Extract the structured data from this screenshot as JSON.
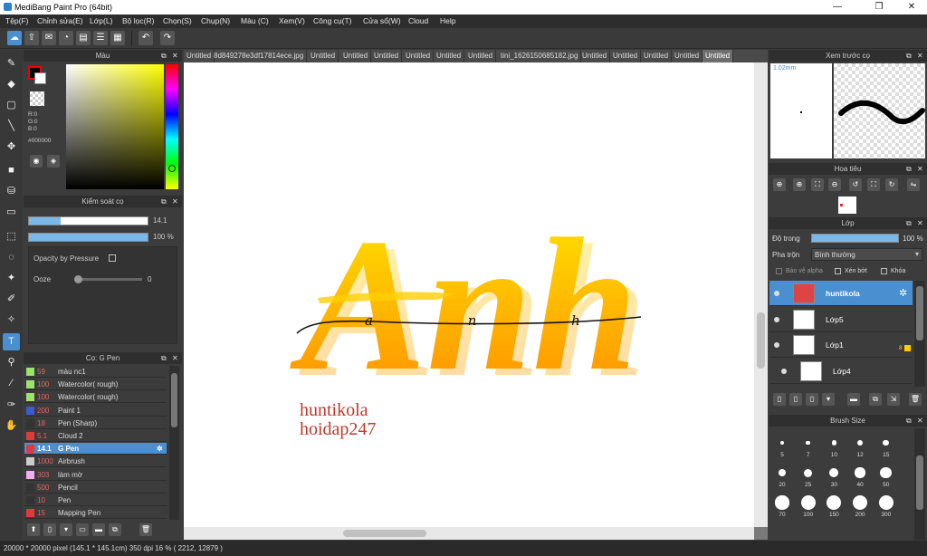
{
  "window": {
    "title": "MediBang Paint Pro (64bit)",
    "controls": [
      "—",
      "❐",
      "✕"
    ]
  },
  "menu": [
    "Tệp(F)",
    "Chỉnh sửa(E)",
    "Lớp(L)",
    "Bộ lọc(R)",
    "Chọn(S)",
    "Chụp(N)",
    "Màu (C)",
    "Xem(V)",
    "Công cụ(T)",
    "Cửa sổ(W)",
    "Cloud",
    "Help"
  ],
  "color_panel": {
    "title": "Màu",
    "r": "R:0",
    "g": "G:0",
    "b": "B:0",
    "hex": "#000000"
  },
  "brush_control": {
    "title": "Kiểm soát cọ",
    "size_value": "14.1",
    "opacity_value": "100 %",
    "size_fill": 0.27,
    "opacity_fill": 1.0,
    "opacity_by_pressure": "Opacity by Pressure",
    "ooze_label": "Ooze",
    "ooze_value": "0"
  },
  "brush_list": {
    "title": "Cọ: G Pen",
    "items": [
      {
        "size": "59",
        "name": "màu nc1",
        "color": "#9be36a"
      },
      {
        "size": "100",
        "name": "Watercolor( rough)",
        "color": "#9be36a"
      },
      {
        "size": "100",
        "name": "Watercolor( rough)",
        "color": "#9be36a"
      },
      {
        "size": "200",
        "name": "Paint 1",
        "color": "#3b5bd6"
      },
      {
        "size": "18",
        "name": "Pen (Sharp)",
        "color": "#333333"
      },
      {
        "size": "5.1",
        "name": "Cloud 2",
        "color": "#e03b3b"
      },
      {
        "size": "14.1",
        "name": "G Pen",
        "color": "#e03b3b",
        "selected": true
      },
      {
        "size": "1000",
        "name": "Airbrush",
        "color": "#cccccc"
      },
      {
        "size": "303",
        "name": "làm mờ",
        "color": "#f0b0f0"
      },
      {
        "size": "500",
        "name": "Pencil",
        "color": "#333333"
      },
      {
        "size": "10",
        "name": "Pen",
        "color": "#333333"
      },
      {
        "size": "15",
        "name": "Mapping Pen",
        "color": "#e03b3b"
      }
    ]
  },
  "tabs": [
    "Untitled",
    "8d849278e3df17814ece.jpg",
    "Untitled",
    "Untitled",
    "Untitled",
    "Untitled",
    "Untitled",
    "Untitled",
    "tini_1626150685182.jpg",
    "Untitled",
    "Untitled",
    "Untitled",
    "Untitled",
    "Untitled"
  ],
  "canvas": {
    "big_text": "Anh",
    "script_text": "a n h",
    "caption_line1": "huntikola",
    "caption_line2": "hoidap247",
    "script_color": "#111111",
    "caption_color": "#c0392b",
    "gradient_top": "#ffe600",
    "gradient_bottom": "#ff8c00"
  },
  "preview_panel": {
    "title": "Xem trước cọ",
    "size_label": "1.02mm"
  },
  "navigator_panel": {
    "title": "Hoa tiêu"
  },
  "layer_panel": {
    "title": "Lớp",
    "opacity_label": "Độ trong",
    "opacity_value": "100 %",
    "blend_label": "Pha trộn",
    "blend_value": "Bình thường",
    "protect_alpha": "Bảo vệ alpha",
    "clipping": "Xén bớt",
    "lock": "Khóa",
    "layers": [
      {
        "name": "huntikola",
        "selected": true
      },
      {
        "name": "Lớp5"
      },
      {
        "name": "Lớp1",
        "badge": "8"
      },
      {
        "name": "Lớp4"
      }
    ]
  },
  "brush_size_panel": {
    "title": "Brush Size",
    "sizes": [
      "5",
      "7",
      "10",
      "12",
      "15",
      "20",
      "25",
      "30",
      "40",
      "50",
      "70",
      "100",
      "150",
      "200",
      "300"
    ]
  },
  "status": "20000 * 20000 pixel  (145.1 * 145.1cm)  350 dpi  16 %  ( 2212, 12879 )",
  "accent": "#4a8fd0"
}
